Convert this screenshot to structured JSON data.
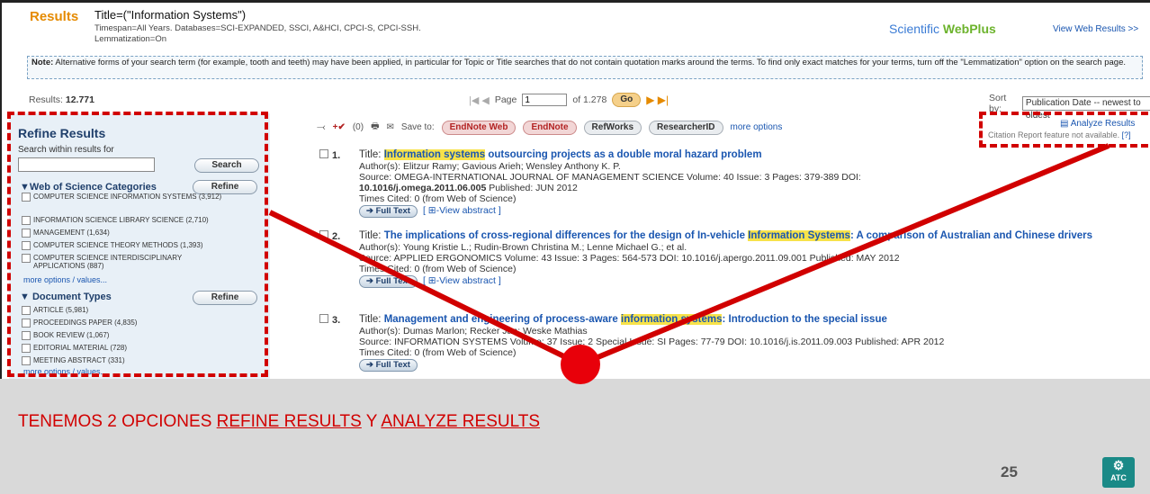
{
  "header": {
    "results_word": "Results",
    "query": "Title=(\"Information Systems\")",
    "meta_line1": "Timespan=All Years. Databases=SCI-EXPANDED, SSCI, A&HCI, CPCI-S, CPCI-SSH.",
    "meta_line2": "Lemmatization=On",
    "brand_prefix": "Scientific ",
    "brand_highlight": "WebPlus",
    "view_web": "View Web Results >>"
  },
  "note": {
    "label": "Note:",
    "text": " Alternative forms of your search term (for example, tooth and teeth) may have been applied, in particular for Topic or Title searches that do not contain quotation marks around the terms. To find only exact matches for your terms, turn off the \"Lemmatization\" option on the search page."
  },
  "nav": {
    "results_label": "Results:",
    "results_count": "12.771",
    "page_label": "Page",
    "page_value": "1",
    "of_label": "of 1.278",
    "go": "Go",
    "sort_label": "Sort by:",
    "sort_value": "Publication Date -- newest to oldest"
  },
  "refine": {
    "title": "Refine Results",
    "search_label": "Search within results for",
    "search_button": "Search",
    "wos_head": "Web of Science Categories",
    "refine_button": "Refine",
    "wos_items": [
      "COMPUTER SCIENCE INFORMATION SYSTEMS (3,912)",
      "INFORMATION SCIENCE LIBRARY SCIENCE (2,710)",
      "MANAGEMENT (1,634)",
      "COMPUTER SCIENCE THEORY METHODS (1,393)",
      "COMPUTER SCIENCE INTERDISCIPLINARY APPLICATIONS (887)"
    ],
    "more1": "more options / values...",
    "doc_head": "Document Types",
    "doc_items": [
      "ARTICLE (5,981)",
      "PROCEEDINGS PAPER (4,835)",
      "BOOK REVIEW (1,067)",
      "EDITORIAL MATERIAL (728)",
      "MEETING ABSTRACT (331)"
    ],
    "more2": "more options / values..."
  },
  "toolbar": {
    "marked": "(0)",
    "save_to": "Save to:",
    "endnote_web": "EndNote Web",
    "endnote": "EndNote",
    "refworks": "RefWorks",
    "researcherid": "ResearcherID",
    "more_options": "more options",
    "analyze": "Analyze Results",
    "citation_prefix": "Citation Report feature not available.",
    "citation_help": "[?]"
  },
  "records": [
    {
      "num": "1.",
      "title_pre": "",
      "title_hl": "Information systems",
      "title_post": " outsourcing projects as a double moral hazard problem",
      "authors": "Author(s): Elitzur Ramy; Gavious Arieh; Wensley Anthony K. P.",
      "source": "Source: OMEGA-INTERNATIONAL JOURNAL OF MANAGEMENT SCIENCE  Volume: 40  Issue: 3  Pages: 379-389  DOI:",
      "doi_line": "10.1016/j.omega.2011.06.005",
      "published": "Published: JUN 2012",
      "cited": "Times Cited: 0 (from Web of Science)",
      "full_text": "Full Text",
      "abstract": "View abstract ]"
    },
    {
      "num": "2.",
      "title_pre": "The implications of cross-regional differences for the design of In-vehicle ",
      "title_hl": "Information Systems",
      "title_post": ": A comparison of Australian and Chinese drivers",
      "authors": "Author(s): Young Kristie L.; Rudin-Brown Christina M.; Lenne Michael G.; et al.",
      "source": "Source: APPLIED ERGONOMICS  Volume: 43  Issue: 3  Pages: 564-573  DOI: 10.1016/j.apergo.2011.09.001  Published: MAY 2012",
      "doi_line": "",
      "published": "",
      "cited": "Times Cited: 0 (from Web of Science)",
      "full_text": "Full Text",
      "abstract": "View abstract ]"
    },
    {
      "num": "3.",
      "title_pre": "Management and engineering of process-aware ",
      "title_hl": "information systems",
      "title_post": ": Introduction to the special issue",
      "authors": "Author(s): Dumas Marlon; Recker Jan; Weske Mathias",
      "source": "Source: INFORMATION SYSTEMS  Volume: 37  Issue: 2  Special Issue: SI  Pages: 77-79  DOI: 10.1016/j.is.2011.09.003  Published: APR 2012",
      "doi_line": "",
      "published": "",
      "cited": "Times Cited: 0 (from Web of Science)",
      "full_text": "Full Text",
      "abstract": ""
    }
  ],
  "slide": {
    "caption_pre": "TENEMOS 2 OPCIONES ",
    "caption_u1": "REFINE RESULTS",
    "caption_mid": " Y ",
    "caption_u2": "ANALYZE RESULTS",
    "page_number": "25",
    "logo_text": "ATC"
  },
  "colors": {
    "accent_orange": "#e58a00",
    "link_blue": "#1a56b0",
    "annotation_red": "#d10000",
    "highlight_yellow": "#f7e24a"
  }
}
